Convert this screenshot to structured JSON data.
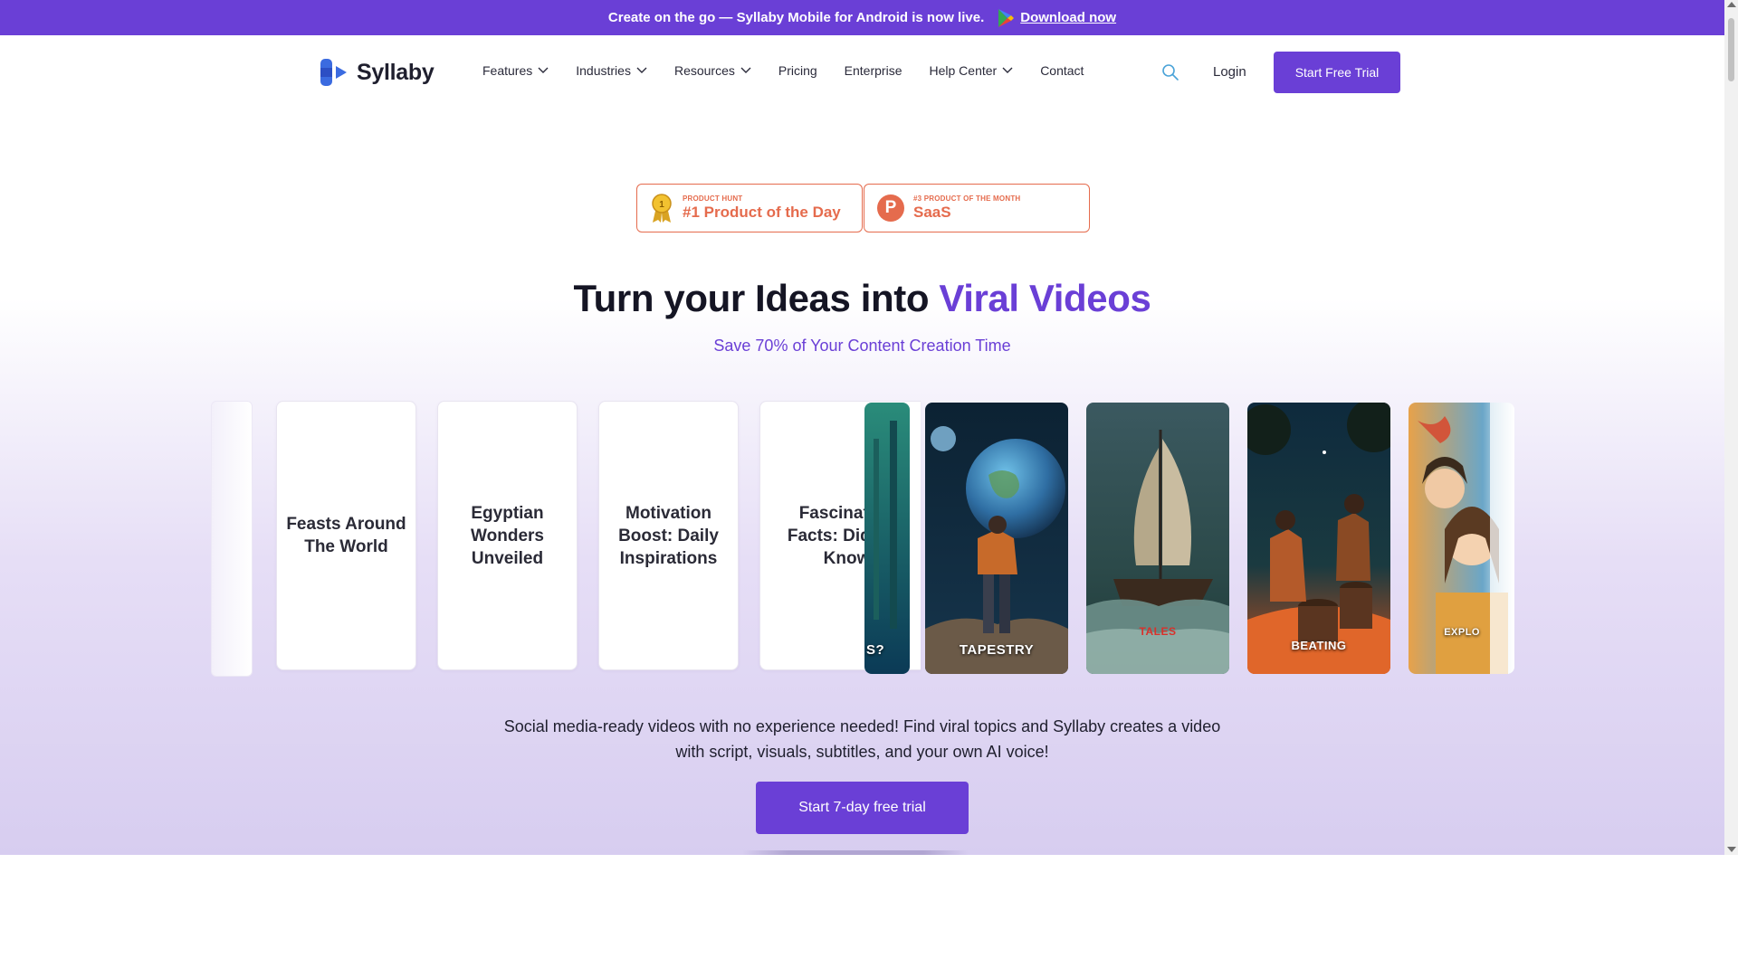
{
  "announcement": {
    "text": "Create on the go — Syllaby Mobile for Android is now live.",
    "link_label": "Download now"
  },
  "header": {
    "logo_text": "Syllaby",
    "nav": [
      {
        "label": "Features",
        "dropdown": true
      },
      {
        "label": "Industries",
        "dropdown": true
      },
      {
        "label": "Resources",
        "dropdown": true
      },
      {
        "label": "Pricing",
        "dropdown": false
      },
      {
        "label": "Enterprise",
        "dropdown": false
      },
      {
        "label": "Help Center",
        "dropdown": true
      },
      {
        "label": "Contact",
        "dropdown": false
      }
    ],
    "login_label": "Login",
    "trial_label": "Start Free Trial"
  },
  "badges": [
    {
      "small": "PRODUCT HUNT",
      "big": "#1 Product of the Day",
      "icon": "medal-icon"
    },
    {
      "small": "#3 PRODUCT OF THE MONTH",
      "big": "SaaS",
      "icon": "product-hunt-icon"
    }
  ],
  "hero": {
    "title_main": "Turn your Ideas into ",
    "title_accent": "Viral Videos",
    "subtitle": "Save 70% of Your Content Creation Time",
    "description_line1": "Social media-ready videos with no experience needed! Find viral topics and Syllaby creates a video",
    "description_line2": "with script, visuals, subtitles, and your own AI voice!",
    "cta_label": "Start 7-day free trial"
  },
  "carousel": {
    "text_cards": [
      "Feasts Around The World",
      "Egyptian Wonders Unveiled",
      "Motivation Boost: Daily Inspirations",
      "Fascinating Facts: Did You Know"
    ],
    "video_cards": [
      {
        "label": "S?"
      },
      {
        "label": "TAPESTRY"
      },
      {
        "label": "TALES"
      },
      {
        "label": "BEATING"
      },
      {
        "label": "EXPLO"
      }
    ]
  },
  "colors": {
    "brand": "#6a3fd6",
    "badge": "#e56b4d"
  }
}
